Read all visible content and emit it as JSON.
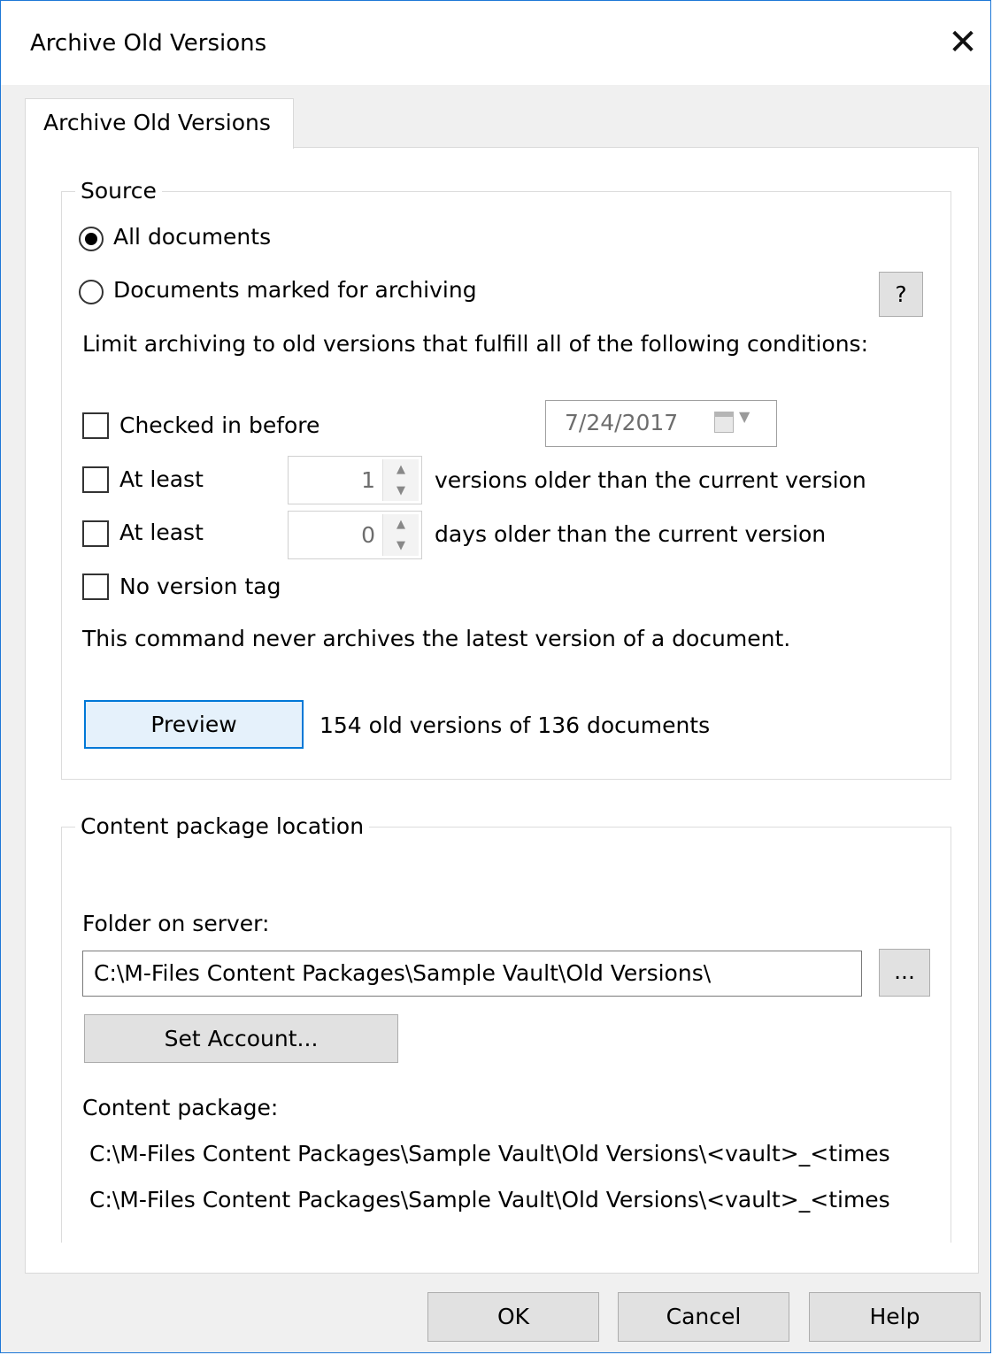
{
  "window": {
    "title": "Archive Old Versions"
  },
  "tab": {
    "label": "Archive Old Versions"
  },
  "source": {
    "legend": "Source",
    "all_documents": "All documents",
    "marked_documents": "Documents marked for archiving",
    "help_label": "?",
    "limit_text": "Limit archiving to old versions that fulfill all of the following conditions:",
    "checked_in_before": "Checked in before",
    "date_value": "7/24/2017",
    "at_least_versions_label": "At least",
    "versions_value": "1",
    "versions_suffix": "versions older than the current version",
    "at_least_days_label": "At least",
    "days_value": "0",
    "days_suffix": "days older than the current version",
    "no_version_tag": "No version tag",
    "note": "This command never archives the latest version of a document.",
    "preview_label": "Preview",
    "preview_result": "154 old versions of 136 documents"
  },
  "content": {
    "legend": "Content package location",
    "folder_label": "Folder on server:",
    "folder_value": "C:\\M-Files Content Packages\\Sample Vault\\Old Versions\\",
    "browse_label": "...",
    "set_account_label": "Set Account...",
    "package_label": "Content package:",
    "package_line1": "C:\\M-Files Content Packages\\Sample Vault\\Old Versions\\<vault>_<times",
    "package_line2": "C:\\M-Files Content Packages\\Sample Vault\\Old Versions\\<vault>_<times"
  },
  "footer": {
    "ok": "OK",
    "cancel": "Cancel",
    "help": "Help"
  }
}
